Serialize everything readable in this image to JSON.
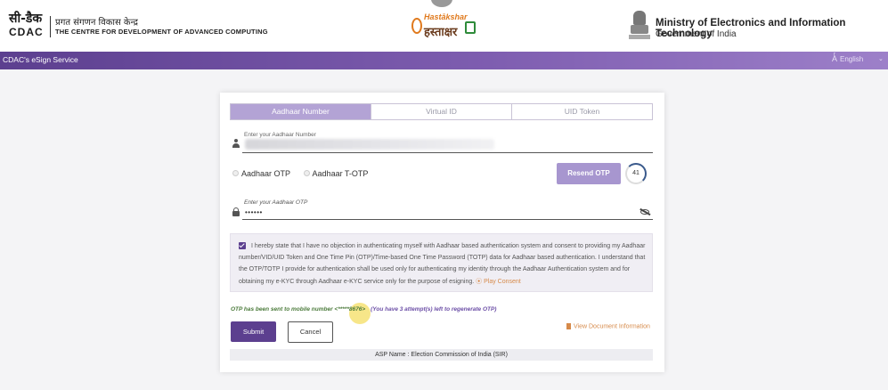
{
  "header": {
    "cdac_logo_hindi": "सी-डैक",
    "cdac_logo_english": "CDAC",
    "cdac_name_hindi": "प्रगत संगणन विकास केन्द्र",
    "cdac_name_english": "THE CENTRE FOR DEVELOPMENT OF ADVANCED COMPUTING",
    "hastakshar_top": "Hastākshar",
    "hastakshar_main": "हस्ताक्षर",
    "ministry": "Ministry of Electronics and Information Technology",
    "government": "Government of India"
  },
  "navbar": {
    "service_title": "CDAC's eSign Service",
    "language_icon": "translate-icon",
    "language": "English",
    "caret": "⌄"
  },
  "tabs": [
    {
      "label": "Aadhaar Number",
      "active": true
    },
    {
      "label": "Virtual ID",
      "active": false
    },
    {
      "label": "UID Token",
      "active": false
    }
  ],
  "aadhaar_field": {
    "label": "Enter your Aadhaar Number"
  },
  "otp_options": {
    "option1": "Aadhaar OTP",
    "option2": "Aadhaar T-OTP"
  },
  "resend": {
    "label": "Resend OTP",
    "timer": "41"
  },
  "otp_field": {
    "label": "Enter your Aadhaar OTP",
    "value": "••••••"
  },
  "consent": {
    "text": "I hereby state that I have no objection in authenticating myself with Aadhaar based authentication system and consent to providing my Aadhaar number/VID/UID Token and One Time Pin (OTP)/Time-based One Time Password (TOTP) data for Aadhaar based authentication. I understand that the OTP/TOTP I provide for authentication shall be used only for authenticating my identity through the Aadhaar Authentication system and for obtaining my e-KYC through Aadhaar e-KYC service only for the purpose of esigning.",
    "play_consent": "⦿ Play Consent"
  },
  "otp_status": {
    "sent": "OTP has been sent to mobile number <*****8676>",
    "attempts": "(You have 3 attempt(s) left to regenerate OTP)"
  },
  "actions": {
    "submit": "Submit",
    "cancel": "Cancel",
    "view_document": "View Document Information"
  },
  "asp_name": "ASP Name : Election Commission of India (SIR)",
  "colors": {
    "brand_purple": "#5c3f8f",
    "tab_active": "#b3a3d5",
    "resend_button": "#a796cf",
    "link_orange": "#d68a4a"
  }
}
